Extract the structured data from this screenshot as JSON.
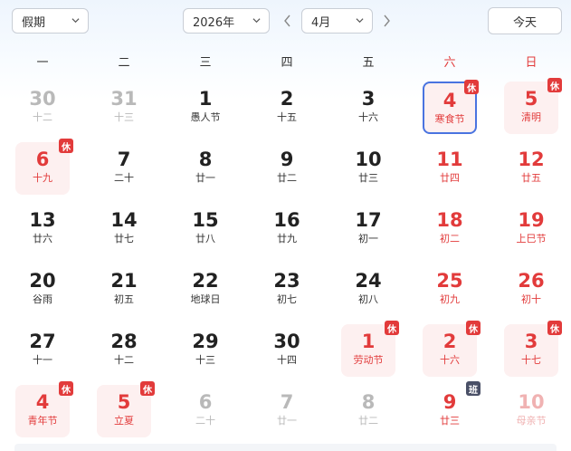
{
  "toolbar": {
    "holiday_select": "假期",
    "year_select": "2026年",
    "month_select": "4月",
    "today_label": "今天"
  },
  "weekdays": [
    "一",
    "二",
    "三",
    "四",
    "五",
    "六",
    "日"
  ],
  "badge_labels": {
    "rest": "休",
    "work": "班"
  },
  "weeks": [
    [
      {
        "day": "30",
        "sub": "十二",
        "muted": true
      },
      {
        "day": "31",
        "sub": "十三",
        "muted": true
      },
      {
        "day": "1",
        "sub": "愚人节",
        "festival": true
      },
      {
        "day": "2",
        "sub": "十五"
      },
      {
        "day": "3",
        "sub": "十六"
      },
      {
        "day": "4",
        "sub": "寒食节",
        "festival": true,
        "badge": "rest",
        "selected": true,
        "holiday": true
      },
      {
        "day": "5",
        "sub": "清明",
        "festival": true,
        "badge": "rest",
        "holiday": true
      }
    ],
    [
      {
        "day": "6",
        "sub": "十九",
        "badge": "rest",
        "holiday": true,
        "red": true
      },
      {
        "day": "7",
        "sub": "二十"
      },
      {
        "day": "8",
        "sub": "廿一"
      },
      {
        "day": "9",
        "sub": "廿二"
      },
      {
        "day": "10",
        "sub": "廿三"
      },
      {
        "day": "11",
        "sub": "廿四"
      },
      {
        "day": "12",
        "sub": "廿五"
      }
    ],
    [
      {
        "day": "13",
        "sub": "廿六"
      },
      {
        "day": "14",
        "sub": "廿七"
      },
      {
        "day": "15",
        "sub": "廿八"
      },
      {
        "day": "16",
        "sub": "廿九"
      },
      {
        "day": "17",
        "sub": "初一"
      },
      {
        "day": "18",
        "sub": "初二"
      },
      {
        "day": "19",
        "sub": "上巳节",
        "festival": true
      }
    ],
    [
      {
        "day": "20",
        "sub": "谷雨",
        "festival": true
      },
      {
        "day": "21",
        "sub": "初五"
      },
      {
        "day": "22",
        "sub": "地球日",
        "festival": true
      },
      {
        "day": "23",
        "sub": "初七"
      },
      {
        "day": "24",
        "sub": "初八"
      },
      {
        "day": "25",
        "sub": "初九"
      },
      {
        "day": "26",
        "sub": "初十"
      }
    ],
    [
      {
        "day": "27",
        "sub": "十一"
      },
      {
        "day": "28",
        "sub": "十二"
      },
      {
        "day": "29",
        "sub": "十三"
      },
      {
        "day": "30",
        "sub": "十四"
      },
      {
        "day": "1",
        "sub": "劳动节",
        "festival": true,
        "badge": "rest",
        "holiday": true,
        "red": true
      },
      {
        "day": "2",
        "sub": "十六",
        "badge": "rest",
        "holiday": true
      },
      {
        "day": "3",
        "sub": "十七",
        "badge": "rest",
        "holiday": true
      }
    ],
    [
      {
        "day": "4",
        "sub": "青年节",
        "festival": true,
        "badge": "rest",
        "holiday": true,
        "red": true
      },
      {
        "day": "5",
        "sub": "立夏",
        "festival": true,
        "badge": "rest",
        "holiday": true,
        "red": true
      },
      {
        "day": "6",
        "sub": "二十",
        "muted": true
      },
      {
        "day": "7",
        "sub": "廿一",
        "muted": true
      },
      {
        "day": "8",
        "sub": "廿二",
        "muted": true
      },
      {
        "day": "9",
        "sub": "廿三",
        "badge": "work"
      },
      {
        "day": "10",
        "sub": "母亲节",
        "muted": true,
        "festival": true
      }
    ]
  ],
  "colors": {
    "weekend_red": "#e23b3b",
    "selected_border": "#4a74e0",
    "holiday_bg": "#fdf0f0",
    "work_badge": "#4a5067"
  }
}
